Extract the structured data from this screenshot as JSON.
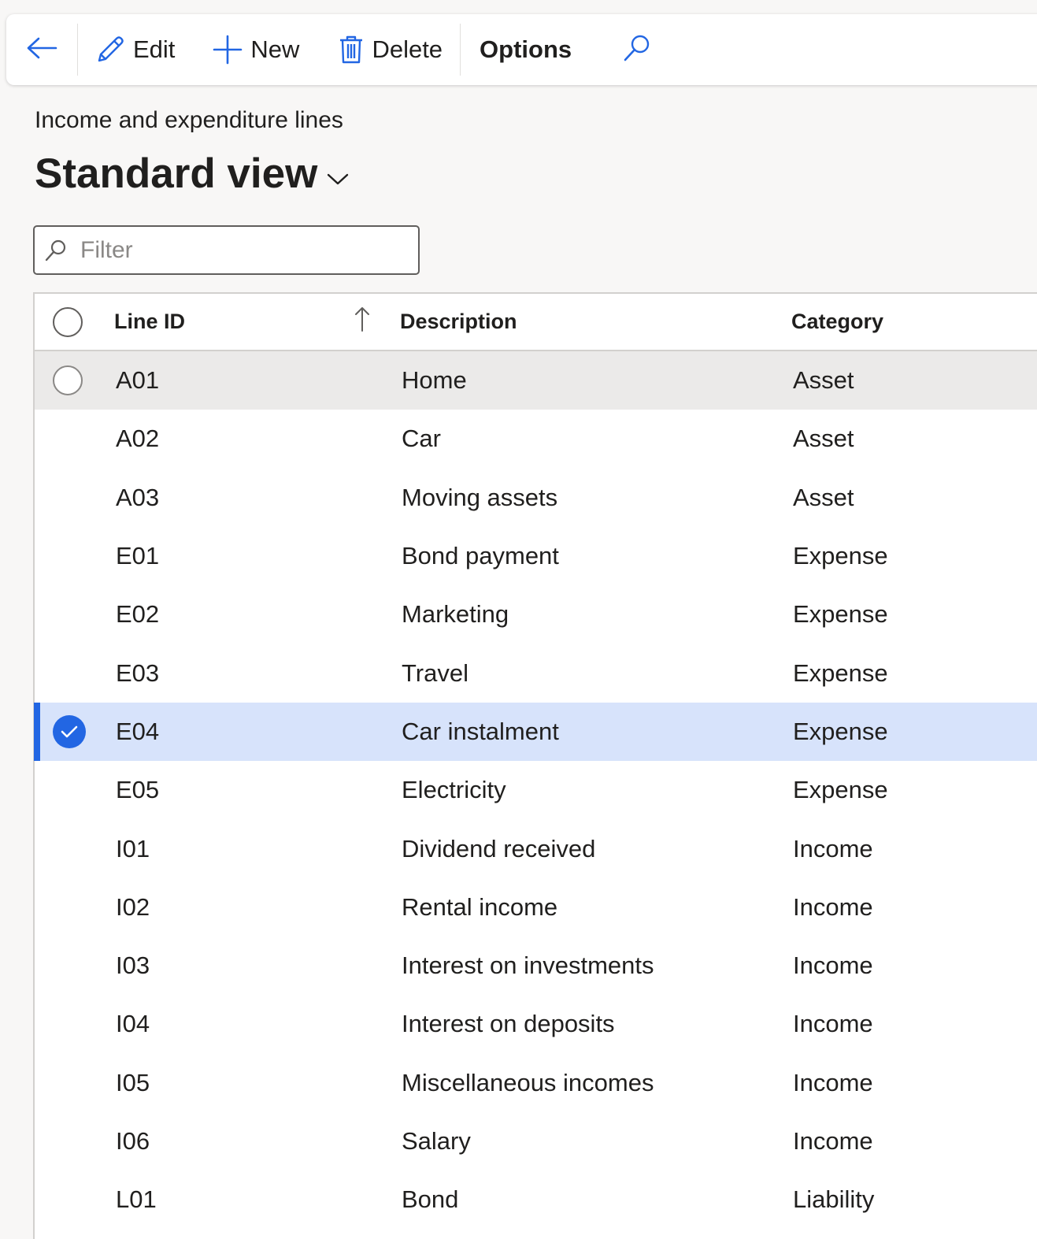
{
  "toolbar": {
    "edit_label": "Edit",
    "new_label": "New",
    "delete_label": "Delete",
    "options_label": "Options"
  },
  "page": {
    "caption": "Income and expenditure lines",
    "view_name": "Standard view"
  },
  "filter": {
    "placeholder": "Filter",
    "value": ""
  },
  "grid": {
    "columns": {
      "line_id": "Line ID",
      "description": "Description",
      "category": "Category"
    },
    "sort": "line-id-ascending",
    "rows": [
      {
        "id": "A01",
        "description": "Home",
        "category": "Asset"
      },
      {
        "id": "A02",
        "description": "Car",
        "category": "Asset"
      },
      {
        "id": "A03",
        "description": "Moving assets",
        "category": "Asset"
      },
      {
        "id": "E01",
        "description": "Bond payment",
        "category": "Expense"
      },
      {
        "id": "E02",
        "description": "Marketing",
        "category": "Expense"
      },
      {
        "id": "E03",
        "description": "Travel",
        "category": "Expense"
      },
      {
        "id": "E04",
        "description": "Car instalment",
        "category": "Expense"
      },
      {
        "id": "E05",
        "description": "Electricity",
        "category": "Expense"
      },
      {
        "id": "I01",
        "description": "Dividend received",
        "category": "Income"
      },
      {
        "id": "I02",
        "description": "Rental income",
        "category": "Income"
      },
      {
        "id": "I03",
        "description": "Interest on investments",
        "category": "Income"
      },
      {
        "id": "I04",
        "description": "Interest on deposits",
        "category": "Income"
      },
      {
        "id": "I05",
        "description": "Miscellaneous incomes",
        "category": "Income"
      },
      {
        "id": "I06",
        "description": "Salary",
        "category": "Income"
      },
      {
        "id": "L01",
        "description": "Bond",
        "category": "Liability"
      }
    ]
  },
  "colors": {
    "accent": "#2266e3",
    "selected_row": "#d7e3fb",
    "hover_row": "#ebeae9",
    "page_bg": "#f8f7f6"
  }
}
